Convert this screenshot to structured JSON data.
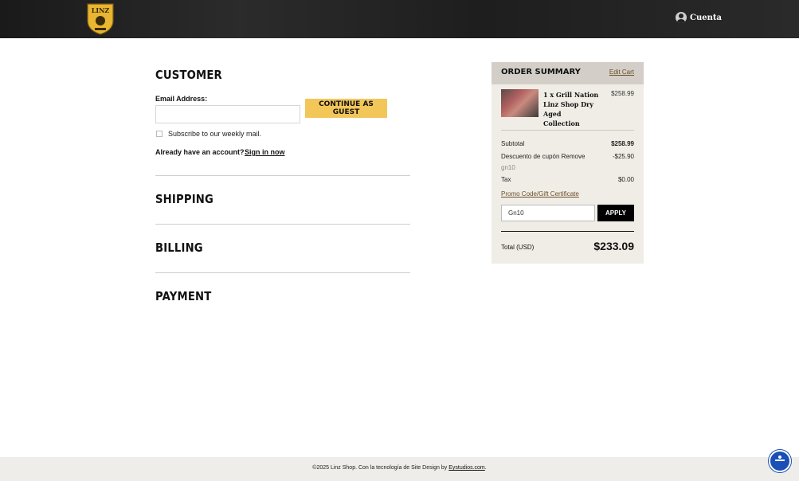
{
  "header": {
    "logo_text": "LINZ",
    "account_label": "Cuenta"
  },
  "checkout": {
    "customer_title": "CUSTOMER",
    "email_label": "Email Address:",
    "email_value": "",
    "continue_label": "CONTINUE AS GUEST",
    "subscribe_label": "Subscribe to our weekly mail.",
    "have_account": "Already have an account?",
    "sign_in": "Sign in now",
    "shipping_title": "SHIPPING",
    "billing_title": "BILLING",
    "payment_title": "PAYMENT"
  },
  "summary": {
    "title": "ORDER SUMMARY",
    "edit_cart": "Edit Cart",
    "item_name": "1 x Grill Nation Linz Shop Dry Aged Collection",
    "item_price": "$258.99",
    "subtotal_label": "Subtotal",
    "subtotal_value": "$258.99",
    "discount_label": "Descuento de cupón Remove",
    "discount_value": "-$25.90",
    "coupon_code": "gn10",
    "tax_label": "Tax",
    "tax_value": "$0.00",
    "promo_link": "Promo Code/Gift Certificate",
    "promo_input_value": "Gn10",
    "apply_label": "APPLY",
    "total_label": "Total (USD)",
    "total_value": "$233.09"
  },
  "footer": {
    "text": "©2025 Linz Shop. Con la tecnología de Site Design by",
    "link": "Eystudios.com",
    "suffix": "."
  },
  "colors": {
    "accent_button": "#f3c65a",
    "summary_bg": "#f0ede6",
    "summary_header": "#d3cfc8",
    "accessibility": "#1a4fb5"
  }
}
